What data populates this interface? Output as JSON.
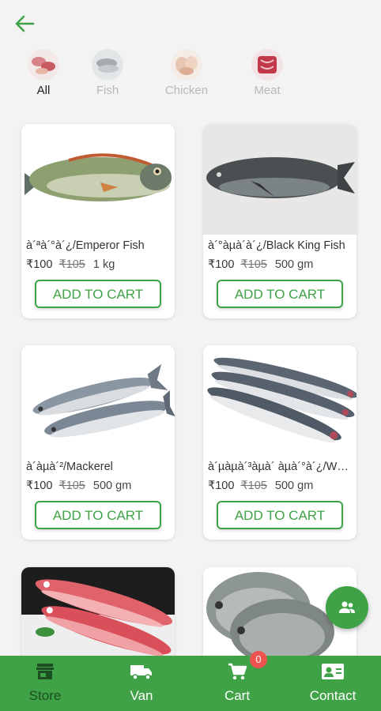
{
  "colors": {
    "primary": "#3fa246",
    "badge": "#ef5350"
  },
  "header": {
    "back_icon": "arrow-left-icon"
  },
  "categories": [
    {
      "label": "All",
      "icon": "mixed-meat-icon",
      "active": true
    },
    {
      "label": "Fish",
      "icon": "fish-icon",
      "active": false
    },
    {
      "label": "Chicken",
      "icon": "chicken-icon",
      "active": false
    },
    {
      "label": "Meat",
      "icon": "meat-icon",
      "active": false
    }
  ],
  "products": [
    {
      "name": "à´ªà´°à´¿/Emperor Fish",
      "price": "₹100",
      "old_price": "₹105",
      "quantity": "1 kg",
      "button": "ADD TO CART",
      "image": "emperor-fish"
    },
    {
      "name": "à´°àµà´à´¿/Black King Fish",
      "price": "₹100",
      "old_price": "₹105",
      "quantity": "500 gm",
      "button": "ADD TO CART",
      "image": "black-king-fish"
    },
    {
      "name": "à´àµà´²/Mackerel",
      "price": "₹100",
      "old_price": "₹105",
      "quantity": "500 gm",
      "button": "ADD TO CART",
      "image": "mackerel"
    },
    {
      "name": "à´µàµà´³àµà´ àµà´°à´¿/White …",
      "price": "₹100",
      "old_price": "₹105",
      "quantity": "500 gm",
      "button": "ADD TO CART",
      "image": "white-sardine"
    },
    {
      "image": "red-snapper"
    },
    {
      "image": "pomfret"
    }
  ],
  "fab": {
    "icon": "people-icon"
  },
  "nav": {
    "store": "Store",
    "van": "Van",
    "cart": "Cart",
    "cart_count": "0",
    "contact": "Contact"
  }
}
